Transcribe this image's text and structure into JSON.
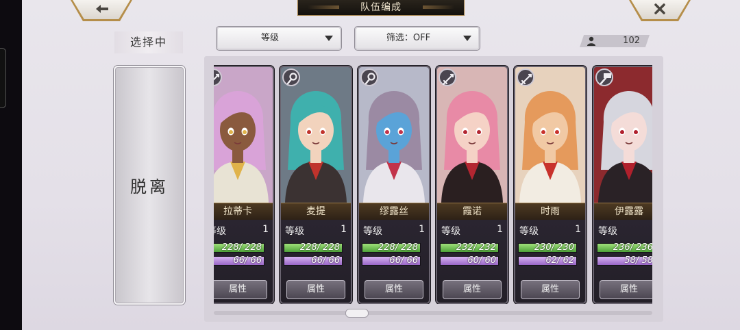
{
  "header": {
    "title": "队伍编成",
    "back_icon": "back-arrow-icon",
    "close_icon": "close-icon"
  },
  "selection": {
    "label": "选择中",
    "leave_label": "脱离"
  },
  "filters": {
    "sort_label": "等级",
    "filter_label": "筛选：OFF"
  },
  "party_count": "102",
  "level_label": "等级",
  "attribute_label": "属性",
  "characters": [
    {
      "name": "拉蒂卡",
      "level": "1",
      "hp": "228/",
      "hp_max": "228",
      "mp": "66/",
      "mp_max": "66",
      "hp_ratio": 1,
      "mp_ratio": 1,
      "element": "sword-icon",
      "skin": "#8a5a3e",
      "hair": "#d9a3d8",
      "outfit": "#e8e3d4",
      "accent": "#e0b34a",
      "bg": "#c9a6c8"
    },
    {
      "name": "麦提",
      "level": "1",
      "hp": "228/",
      "hp_max": "228",
      "mp": "66/",
      "mp_max": "66",
      "hp_ratio": 1,
      "mp_ratio": 1,
      "element": "wand-icon",
      "skin": "#f2d3bd",
      "hair": "#3fb0ad",
      "outfit": "#3b3232",
      "accent": "#c0332c",
      "bg": "#6e7a86"
    },
    {
      "name": "缪露丝",
      "level": "1",
      "hp": "228/",
      "hp_max": "228",
      "mp": "66/",
      "mp_max": "66",
      "hp_ratio": 1,
      "mp_ratio": 1,
      "element": "wand-icon",
      "skin": "#5aa3d8",
      "hair": "#9b8aa3",
      "outfit": "#e9e6ec",
      "accent": "#c2334a",
      "bg": "#b7b9c9"
    },
    {
      "name": "霞诺",
      "level": "1",
      "hp": "232/",
      "hp_max": "232",
      "mp": "60/",
      "mp_max": "60",
      "hp_ratio": 1,
      "mp_ratio": 1,
      "element": "sword-icon",
      "skin": "#f5d2c6",
      "hair": "#e88aa6",
      "outfit": "#2a1f20",
      "accent": "#b32631",
      "bg": "#d8b6b5"
    },
    {
      "name": "时雨",
      "level": "1",
      "hp": "230/",
      "hp_max": "230",
      "mp": "62/",
      "mp_max": "62",
      "hp_ratio": 1,
      "mp_ratio": 1,
      "element": "sword-icon",
      "skin": "#f1c9a4",
      "hair": "#e59a5c",
      "outfit": "#f2ece2",
      "accent": "#c8322c",
      "bg": "#e7d2bd"
    },
    {
      "name": "伊露露",
      "level": "1",
      "hp": "236/",
      "hp_max": "236",
      "mp": "58/",
      "mp_max": "58",
      "hp_ratio": 1,
      "mp_ratio": 1,
      "element": "hammer-icon",
      "skin": "#f4dcd8",
      "hair": "#d6d6de",
      "outfit": "#2a2226",
      "accent": "#b0202c",
      "bg": "#8c2a2e"
    }
  ]
}
